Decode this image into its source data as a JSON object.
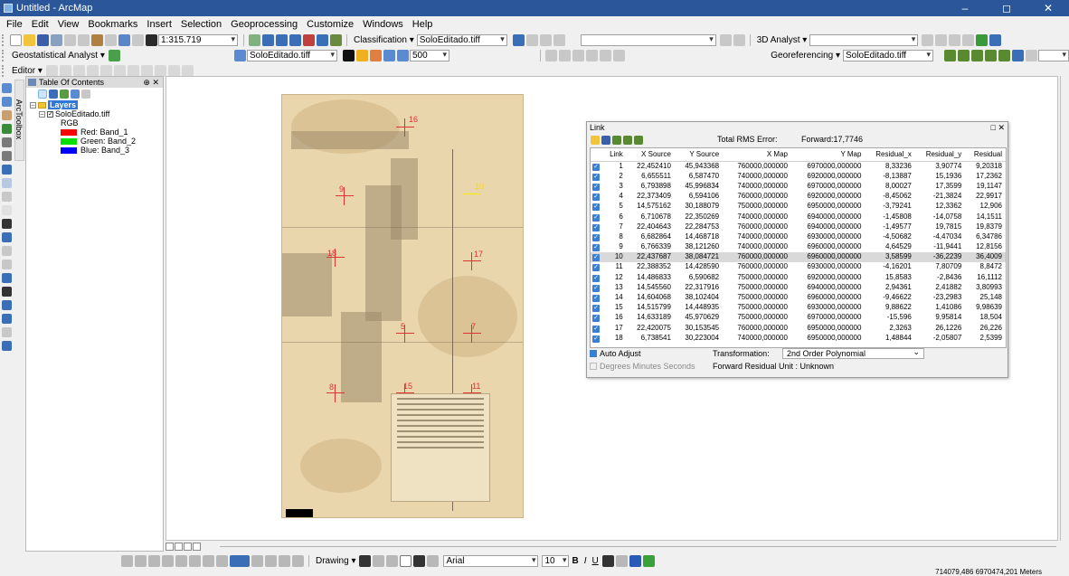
{
  "window": {
    "title": "Untitled - ArcMap",
    "controls": [
      "–",
      "◻",
      "✕"
    ]
  },
  "menu": [
    "File",
    "Edit",
    "View",
    "Bookmarks",
    "Insert",
    "Selection",
    "Geoprocessing",
    "Customize",
    "Windows",
    "Help"
  ],
  "toolbar1": {
    "scale": "1:315.719",
    "classification_label": "Classification ▾",
    "classification_layer": "SoloEditado.tiff",
    "analyst3d_label": "3D Analyst ▾"
  },
  "toolbar2": {
    "geostat_label": "Geostatistical Analyst ▾",
    "layer_combo": "SoloEditado.tiff",
    "zoom_value": "500",
    "georef_label": "Georeferencing ▾",
    "georef_layer": "SoloEditado.tiff"
  },
  "toolbar3": {
    "editor_label": "Editor ▾"
  },
  "toc": {
    "title": "Table Of Contents",
    "pin": "⊕ ✕",
    "layers_label": "Layers",
    "layer_name": "SoloEditado.tiff",
    "rgb_label": "RGB",
    "bands": [
      {
        "label": "Red:   Band_1",
        "color": "#ff0000"
      },
      {
        "label": "Green: Band_2",
        "color": "#00e000"
      },
      {
        "label": "Blue:  Band_3",
        "color": "#0000ff"
      }
    ],
    "arctoolbox_tab": "ArcToolbox"
  },
  "map": {
    "gcp_labels": [
      "16",
      "9",
      "10",
      "18",
      "17",
      "5",
      "7",
      "8",
      "15",
      "11",
      "12"
    ]
  },
  "link": {
    "title": "Link",
    "close": "□ ✕",
    "rms_label": "Total RMS Error:",
    "rms_value": "Forward:17,7746",
    "headers": [
      "Link",
      "X Source",
      "Y Source",
      "X Map",
      "Y Map",
      "Residual_x",
      "Residual_y",
      "Residual"
    ],
    "rows": [
      [
        "1",
        "22,452410",
        "45,943368",
        "760000,000000",
        "6970000,000000",
        "8,33236",
        "3,90774",
        "9,20318"
      ],
      [
        "2",
        "6,655511",
        "6,587470",
        "740000,000000",
        "6920000,000000",
        "-8,13887",
        "15,1936",
        "17,2362"
      ],
      [
        "3",
        "6,793898",
        "45,996834",
        "740000,000000",
        "6970000,000000",
        "8,00027",
        "17,3599",
        "19,1147"
      ],
      [
        "4",
        "22,373409",
        "6,594106",
        "760000,000000",
        "6920000,000000",
        "-8,45062",
        "-21,3824",
        "22,9917"
      ],
      [
        "5",
        "14,575162",
        "30,188079",
        "750000,000000",
        "6950000,000000",
        "-3,79241",
        "12,3362",
        "12,906"
      ],
      [
        "6",
        "6,710678",
        "22,350269",
        "740000,000000",
        "6940000,000000",
        "-1,45808",
        "-14,0758",
        "14,1511"
      ],
      [
        "7",
        "22,404643",
        "22,284753",
        "760000,000000",
        "6940000,000000",
        "-1,49577",
        "19,7815",
        "19,8379"
      ],
      [
        "8",
        "6,682864",
        "14,468718",
        "740000,000000",
        "6930000,000000",
        "-4,50682",
        "-4,47034",
        "6,34786"
      ],
      [
        "9",
        "6,766339",
        "38,121260",
        "740000,000000",
        "6960000,000000",
        "4,64529",
        "-11,9441",
        "12,8156"
      ],
      [
        "10",
        "22,437687",
        "38,084721",
        "760000,000000",
        "6960000,000000",
        "3,58599",
        "-36,2239",
        "36,4009"
      ],
      [
        "11",
        "22,388352",
        "14,428590",
        "760000,000000",
        "6930000,000000",
        "-4,16201",
        "7,80709",
        "8,8472"
      ],
      [
        "12",
        "14,486833",
        "6,590682",
        "750000,000000",
        "6920000,000000",
        "15,8583",
        "-2,8436",
        "16,1112"
      ],
      [
        "13",
        "14,545560",
        "22,317916",
        "750000,000000",
        "6940000,000000",
        "2,94361",
        "2,41882",
        "3,80993"
      ],
      [
        "14",
        "14,604068",
        "38,102404",
        "750000,000000",
        "6960000,000000",
        "-9,46622",
        "-23,2983",
        "25,148"
      ],
      [
        "15",
        "14,515799",
        "14,448935",
        "750000,000000",
        "6930000,000000",
        "9,88622",
        "1,41086",
        "9,98639"
      ],
      [
        "16",
        "14,633189",
        "45,970629",
        "750000,000000",
        "6970000,000000",
        "-15,596",
        "9,95814",
        "18,504"
      ],
      [
        "17",
        "22,420075",
        "30,153545",
        "760000,000000",
        "6950000,000000",
        "2,3263",
        "26,1226",
        "26,226"
      ],
      [
        "18",
        "6,738541",
        "30,223004",
        "740000,000000",
        "6950000,000000",
        "1,48844",
        "-2,05807",
        "2,5399"
      ]
    ],
    "selected_row": 9,
    "auto_adjust": "Auto Adjust",
    "dms": "Degrees Minutes Seconds",
    "transformation_label": "Transformation:",
    "transformation_value": "2nd Order Polynomial",
    "residual_unit": "Forward Residual Unit : Unknown"
  },
  "drawbar": {
    "drawing_label": "Drawing ▾",
    "font": "Arial",
    "font_size": "10"
  },
  "status": {
    "coords": "714079,486  6970474,201 Meters"
  }
}
